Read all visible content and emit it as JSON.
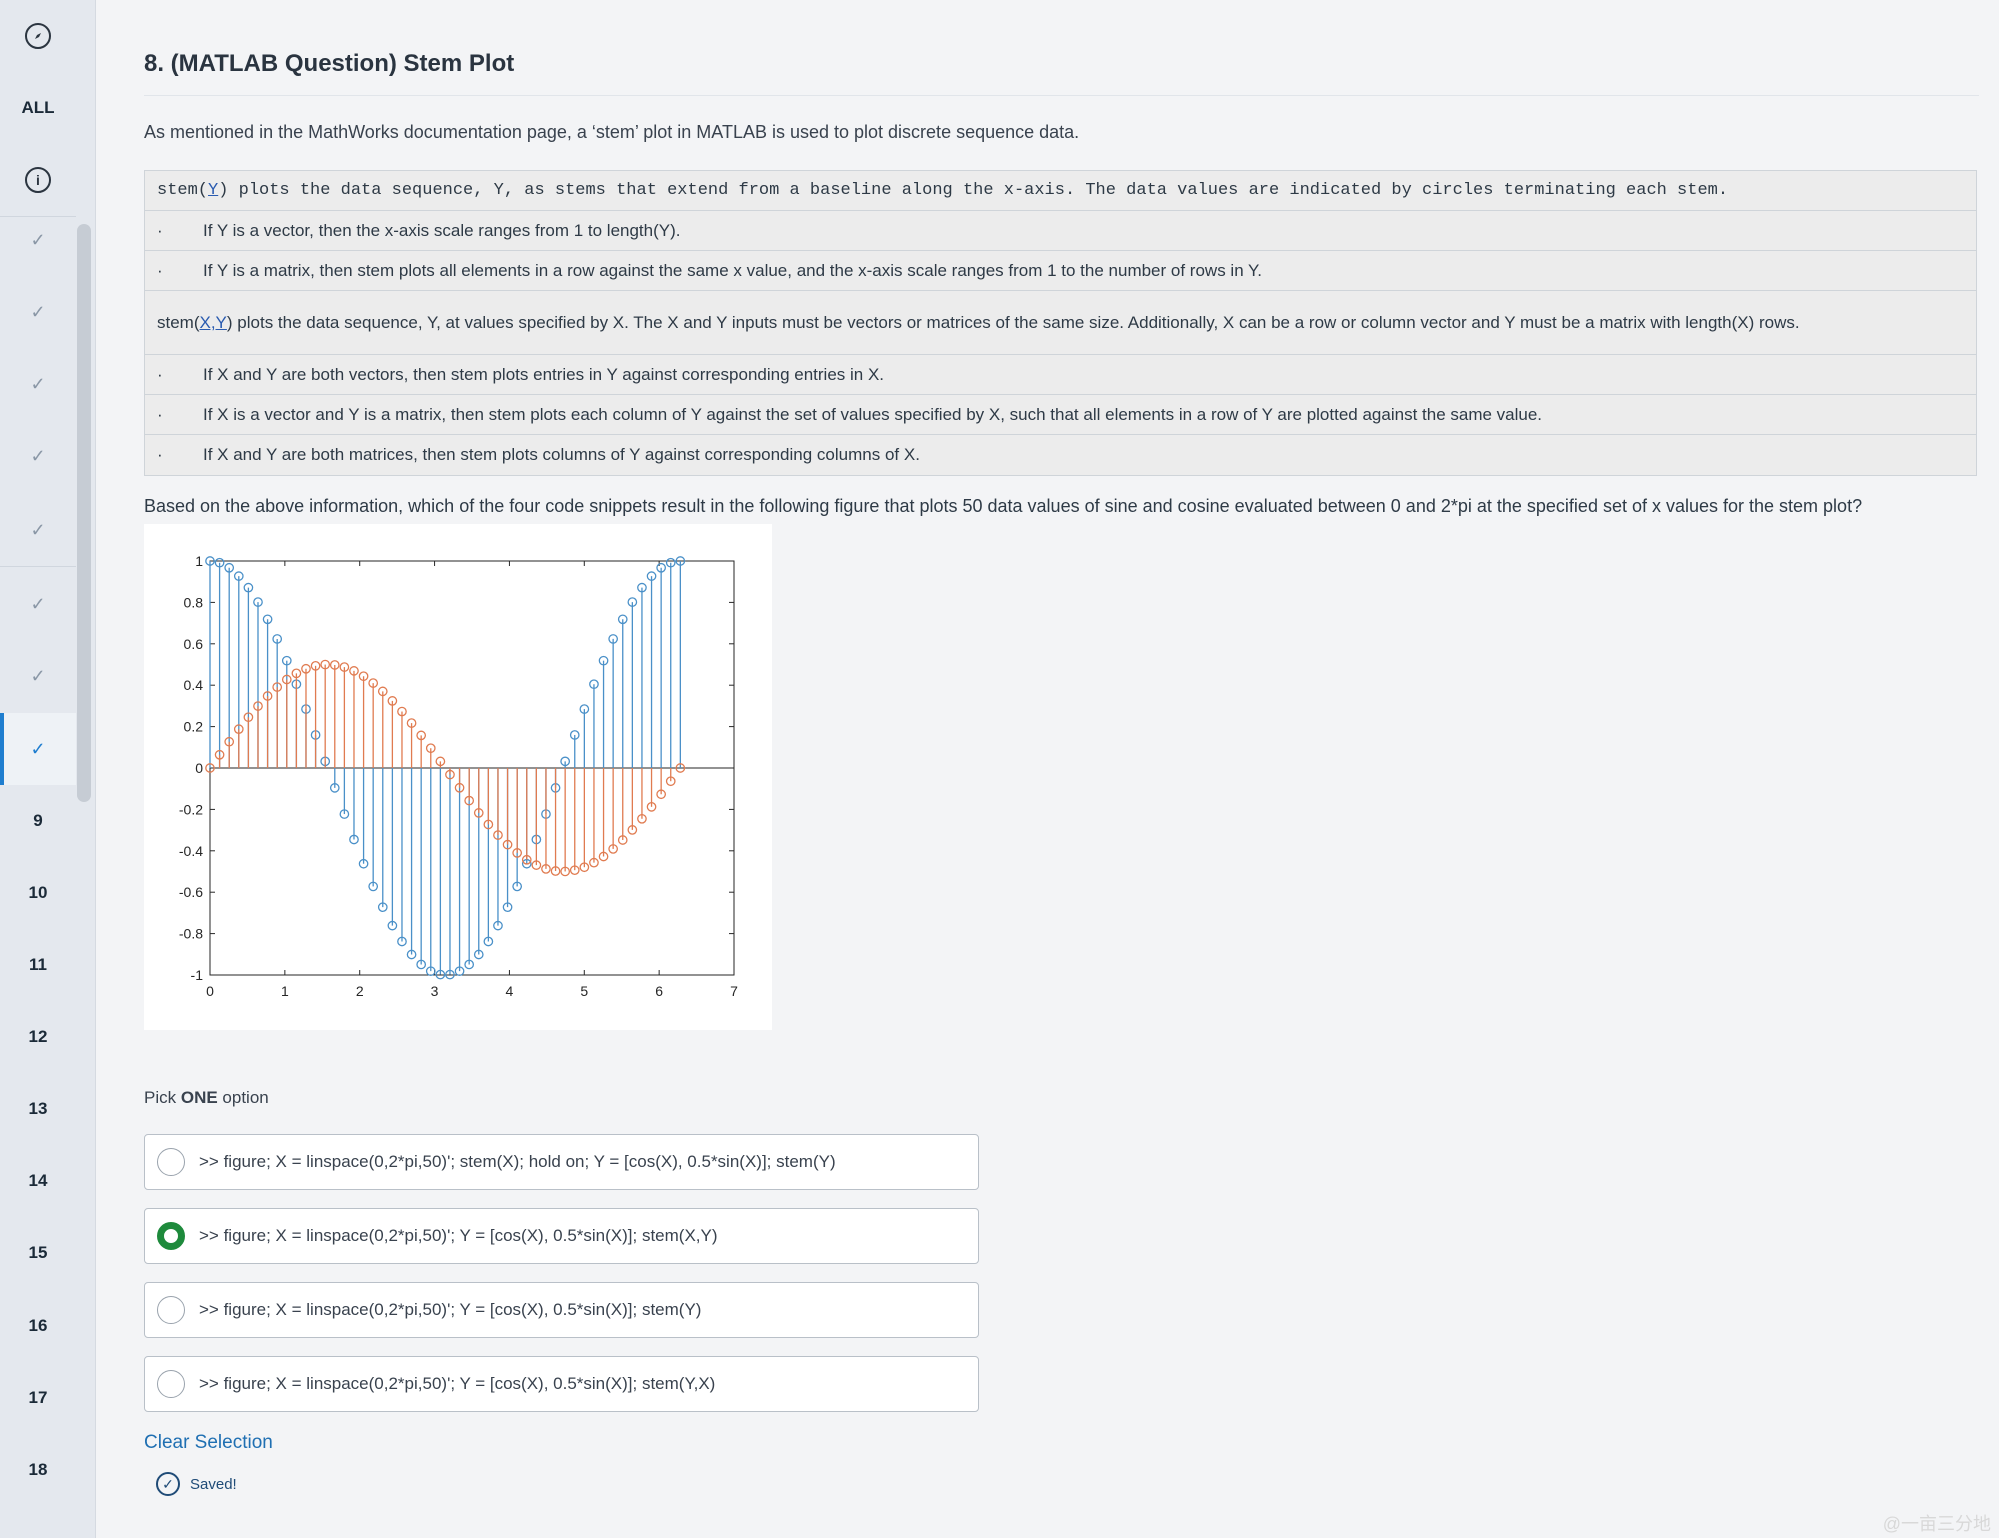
{
  "sidebar": {
    "top_items": [
      "ALL"
    ],
    "numbered_items": [
      "9",
      "10",
      "11",
      "12",
      "13",
      "14",
      "15",
      "16",
      "17",
      "18"
    ],
    "check_count": 8
  },
  "question": {
    "title": "8. (MATLAB Question) Stem Plot",
    "intro": "As mentioned in the MathWorks documentation page, a ‘stem’ plot in MATLAB is used to plot discrete sequence data.",
    "doc": {
      "row1_prefix": "stem(",
      "row1_link": "Y",
      "row1_suffix": ") plots the data sequence, Y, as stems that extend from a baseline along the x-axis. The data values are indicated by circles terminating each stem.",
      "bullets_a": [
        "If Y is a vector, then the x-axis scale ranges from 1 to length(Y).",
        "If Y is a matrix, then stem plots all elements in a row against the same x value, and the x-axis scale ranges from 1 to the number of rows in Y."
      ],
      "row4_prefix": "stem(",
      "row4_link": "X,Y",
      "row4_suffix": ") plots the data sequence, Y, at values specified by X. The X and Y inputs must be vectors or matrices of the same size. Additionally, X can be a row or column vector and Y must be a matrix with length(X) rows.",
      "bullets_b": [
        "If X and Y are both vectors, then stem plots entries in Y against corresponding entries in X.",
        "If X is a vector and Y is a matrix, then stem plots each column of Y against the set of values specified by X, such that all elements in a row of Y are plotted against the same value.",
        "If X and Y are both matrices, then stem plots columns of Y against corresponding columns of X."
      ],
      "bullet_char": "·"
    },
    "prompt": "Based on the above information, which of the four code snippets result in the following figure that plots 50 data values of sine and cosine evaluated between 0 and 2*pi at the specified set of x values for the stem plot?",
    "pick_prefix": "Pick ",
    "pick_bold": "ONE",
    "pick_suffix": " option",
    "options": [
      ">> figure; X = linspace(0,2*pi,50)'; stem(X); hold on; Y = [cos(X), 0.5*sin(X)]; stem(Y)",
      ">> figure; X = linspace(0,2*pi,50)'; Y = [cos(X), 0.5*sin(X)]; stem(X,Y)",
      ">> figure; X = linspace(0,2*pi,50)'; Y = [cos(X), 0.5*sin(X)]; stem(Y)",
      ">> figure; X = linspace(0,2*pi,50)'; Y = [cos(X), 0.5*sin(X)]; stem(Y,X)"
    ],
    "selected_option": 1,
    "clear_label": "Clear Selection",
    "saved_label": "Saved!"
  },
  "chart_data": {
    "type": "stem",
    "xlim": [
      0,
      7
    ],
    "ylim": [
      -1,
      1
    ],
    "xticks": [
      "0",
      "1",
      "2",
      "3",
      "4",
      "5",
      "6",
      "7"
    ],
    "yticks": [
      "-1",
      "-0.8",
      "-0.6",
      "-0.4",
      "-0.2",
      "0",
      "0.2",
      "0.4",
      "0.6",
      "0.8",
      "1"
    ],
    "x_count": 50,
    "x_range": [
      0,
      6.2832
    ],
    "series": [
      {
        "formula": "cos(x)",
        "color": "#4a90c8"
      },
      {
        "formula": "0.5*sin(x)",
        "color": "#e07b50"
      }
    ]
  },
  "watermark": "@一亩三分地",
  "colors": {
    "accent": "#1f7ecf",
    "selected_radio": "#1e8a3c",
    "link": "#1f6fb2"
  }
}
